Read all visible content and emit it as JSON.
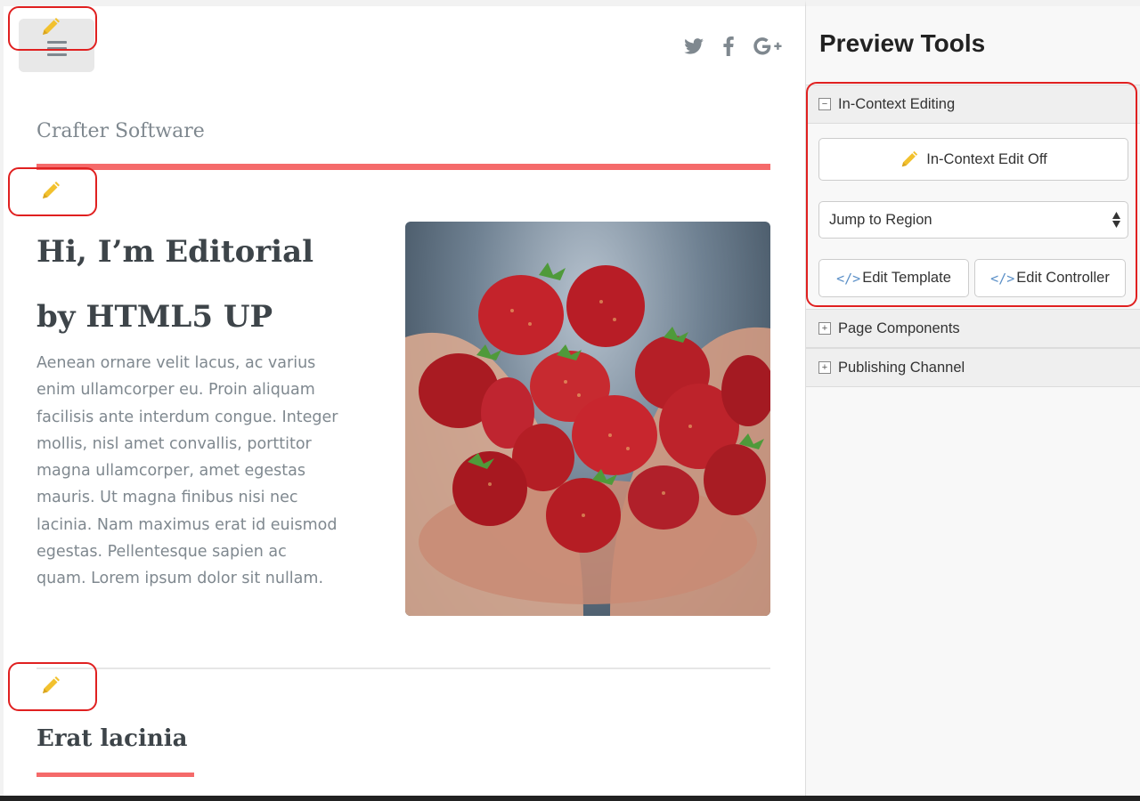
{
  "site": {
    "logo": "Crafter Software",
    "social": [
      "twitter-icon",
      "facebook-icon",
      "google-plus-icon"
    ],
    "hero": {
      "title_line1": "Hi, I’m Editorial",
      "title_line2": "by HTML5 UP",
      "text": "Aenean ornare velit lacus, ac varius enim ullamcorper eu. Proin aliquam facilisis ante interdum congue. Integer mollis, nisl amet convallis, porttitor magna ullamcorper, amet egestas mauris. Ut magna finibus nisi nec lacinia. Nam maximus erat id euismod egestas. Pellentesque sapien ac quam. Lorem ipsum dolor sit nullam."
    },
    "section": {
      "title": "Erat lacinia"
    }
  },
  "panel": {
    "title": "Preview Tools",
    "ice": {
      "header": "In-Context Editing",
      "toggle_label": "In-Context Edit Off",
      "jump_label": "Jump to Region",
      "edit_template": "Edit Template",
      "edit_controller": "Edit Controller"
    },
    "page_components": "Page Components",
    "publishing_channel": "Publishing Channel"
  },
  "colors": {
    "accent": "#f56a6a",
    "pencil": "#f2c12e",
    "highlight": "#e02020"
  }
}
